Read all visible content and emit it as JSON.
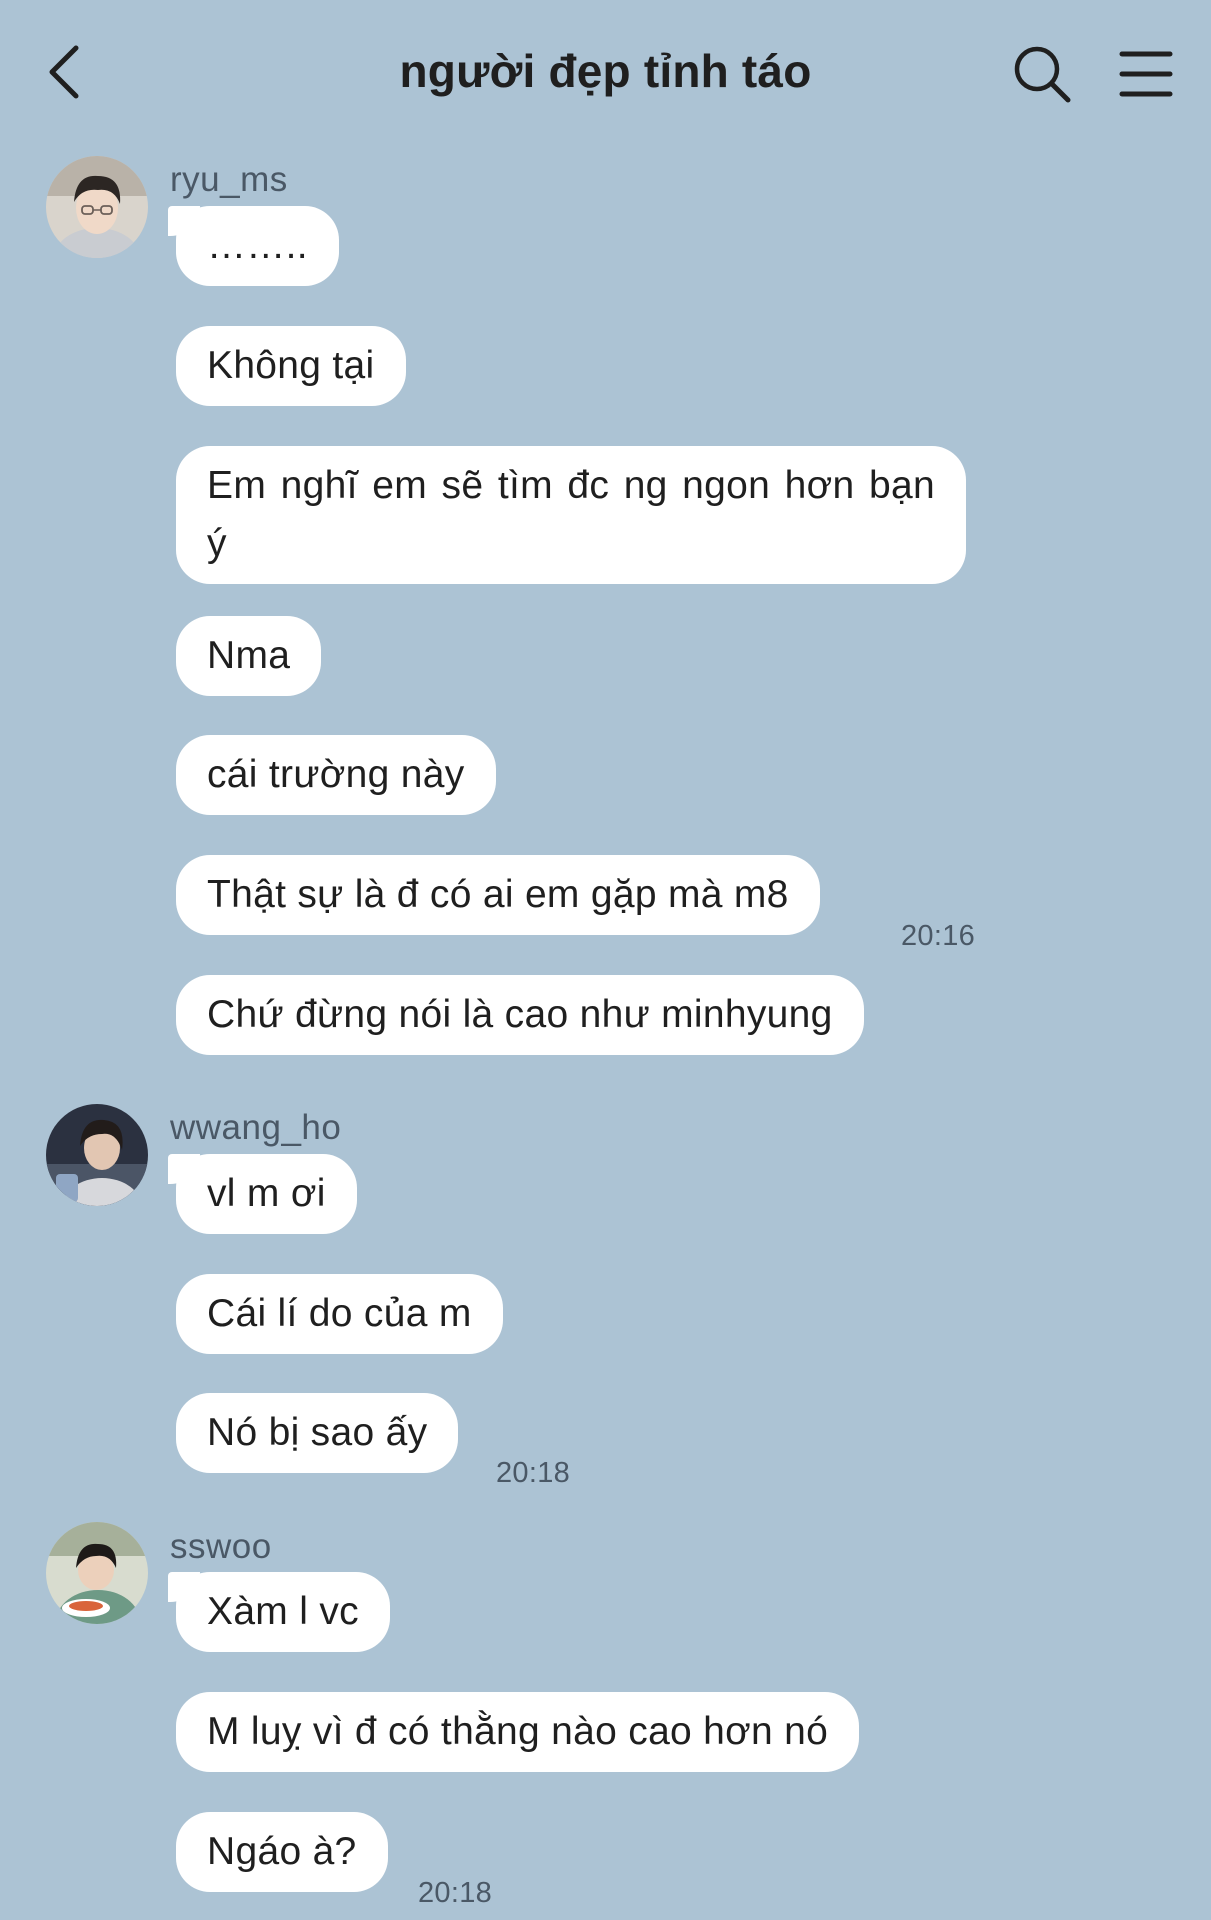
{
  "header": {
    "title": "người đẹp tỉnh táo",
    "back_icon": "chevron-left-icon",
    "search_icon": "search-icon",
    "menu_icon": "menu-icon"
  },
  "messages": [
    {
      "sender": "ryu_ms",
      "lines": [
        "……..",
        "Không tại",
        "Em nghĩ em sẽ tìm đc ng ngon hơn bạn ý",
        "Nma",
        "cái trường này",
        "Thật sự là đ có ai em gặp mà m8",
        "Chứ đừng nói là cao như minhyung"
      ],
      "time": "20:16"
    },
    {
      "sender": "wwang_ho",
      "lines": [
        "vl m ơi",
        "Cái lí do của m",
        "Nó bị sao ấy"
      ],
      "time": "20:18"
    },
    {
      "sender": "sswoo",
      "lines": [
        "Xàm l vc",
        "M luỵ vì đ có thằng nào cao hơn nó",
        "Ngáo à?"
      ],
      "time": "20:18"
    }
  ],
  "colors": {
    "background": "#acc3d4",
    "bubble": "#ffffff",
    "meta_text": "#4a5866"
  }
}
